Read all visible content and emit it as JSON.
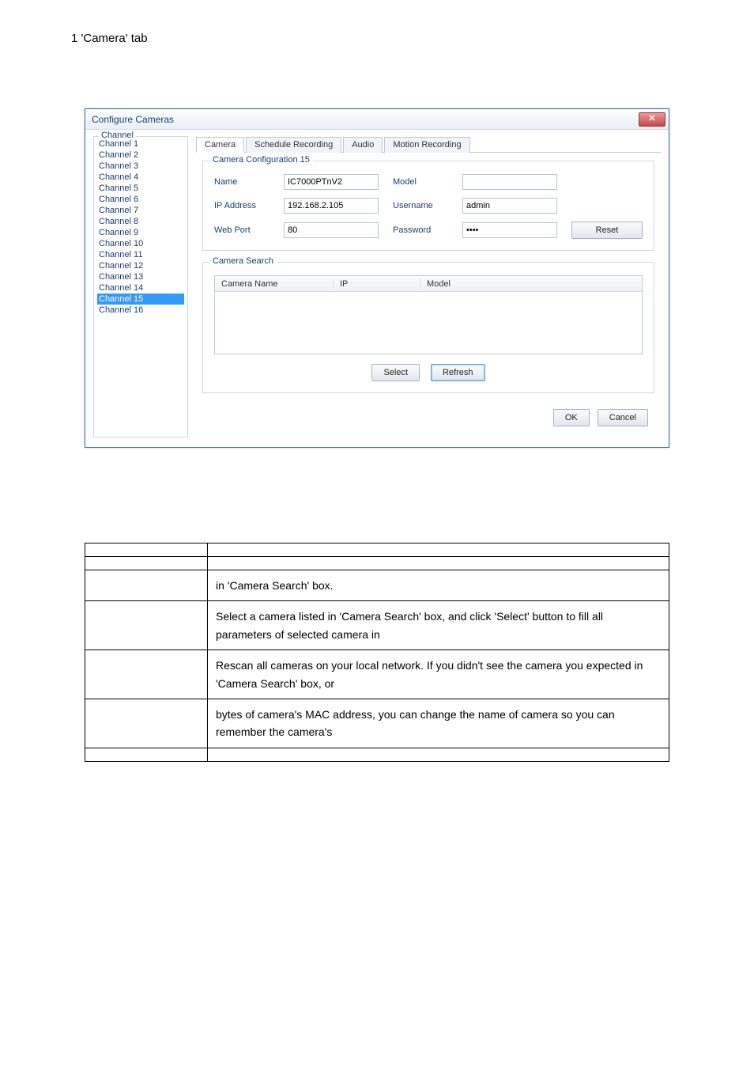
{
  "doc_heading": "1 'Camera' tab",
  "dialog": {
    "title": "Configure Cameras",
    "close_glyph": "✕"
  },
  "channel_group_label": "Channel",
  "channels": [
    "Channel 1",
    "Channel 2",
    "Channel 3",
    "Channel 4",
    "Channel 5",
    "Channel 6",
    "Channel 7",
    "Channel 8",
    "Channel 9",
    "Channel 10",
    "Channel 11",
    "Channel 12",
    "Channel 13",
    "Channel 14",
    "Channel 15",
    "Channel 16"
  ],
  "selected_channel_index": 14,
  "tabs": {
    "items": [
      "Camera",
      "Schedule Recording",
      "Audio",
      "Motion Recording"
    ],
    "active_index": 0
  },
  "config_fieldset_label": "Camera Configuration 15",
  "fields": {
    "name_label": "Name",
    "name_value": "IC7000PTnV2",
    "model_label": "Model",
    "model_value": "",
    "ip_label": "IP Address",
    "ip_value": "192.168.2.105",
    "user_label": "Username",
    "user_value": "admin",
    "port_label": "Web Port",
    "port_value": "80",
    "pass_label": "Password",
    "pass_value": "••••",
    "reset_btn": "Reset"
  },
  "search_fieldset_label": "Camera Search",
  "search_columns": {
    "c1": "Camera Name",
    "c2": "IP",
    "c3": "Model"
  },
  "search_buttons": {
    "select": "Select",
    "refresh": "Refresh"
  },
  "footer": {
    "ok": "OK",
    "cancel": "Cancel"
  },
  "desc_rows": [
    {
      "label": "",
      "text": ""
    },
    {
      "label": "",
      "text": ""
    },
    {
      "label": "",
      "text": "in 'Camera Search' box."
    },
    {
      "label": "",
      "text": "Select a camera listed in 'Camera Search' box, and click 'Select' button to fill all parameters of selected camera in"
    },
    {
      "label": "",
      "text": "Rescan all cameras on your local network. If you didn't see the camera you expected in 'Camera Search' box, or"
    },
    {
      "label": "",
      "text": "bytes of camera's MAC address, you can change the name of camera so you can remember the camera's"
    },
    {
      "label": "",
      "text": ""
    }
  ]
}
